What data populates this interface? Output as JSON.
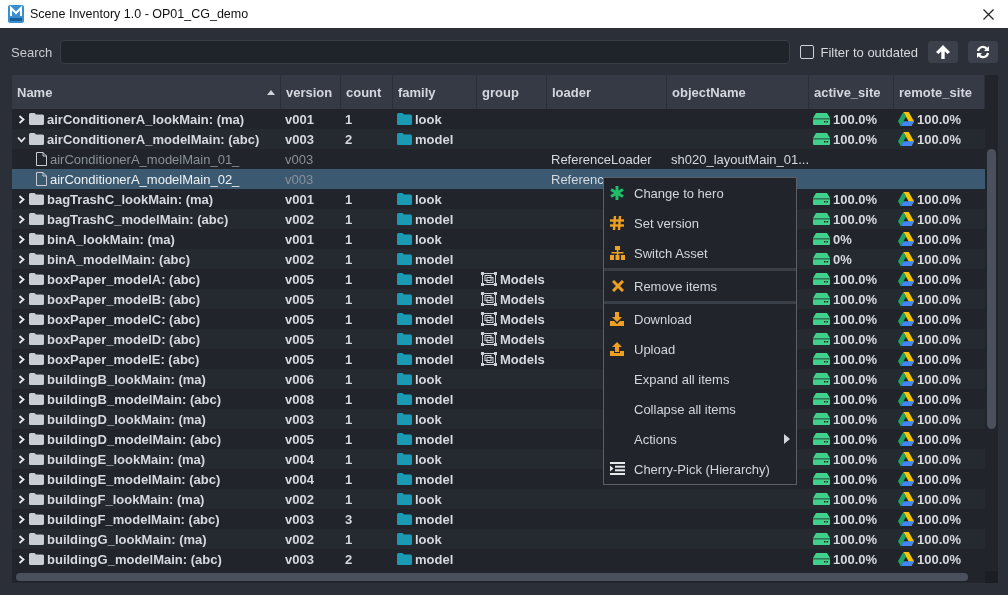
{
  "window": {
    "title": "Scene Inventory 1.0 - OP01_CG_demo"
  },
  "search": {
    "label": "Search"
  },
  "filter_outdated": {
    "label": "Filter to outdated",
    "checked": false
  },
  "table": {
    "columns": [
      {
        "label": "Name",
        "sorted": true
      },
      {
        "label": "version",
        "sorted": false
      },
      {
        "label": "count",
        "sorted": false
      },
      {
        "label": "family",
        "sorted": false
      },
      {
        "label": "group",
        "sorted": false
      },
      {
        "label": "loader",
        "sorted": false
      },
      {
        "label": "objectName",
        "sorted": false
      },
      {
        "label": "active_site",
        "sorted": false
      },
      {
        "label": "remote_site",
        "sorted": false
      }
    ],
    "rows": [
      {
        "name": "airConditionerA_lookMain: (ma)",
        "version": "v001",
        "count": "1",
        "family": "look",
        "active_site": "100.0%",
        "remote_site": "100.0%",
        "expanded": false,
        "selected": false
      },
      {
        "name": "airConditionerA_modelMain: (abc)",
        "version": "v003",
        "count": "2",
        "family": "model",
        "active_site": "100.0%",
        "remote_site": "100.0%",
        "expanded": true,
        "selected": false,
        "children": [
          {
            "name": "airConditionerA_modelMain_01_",
            "version": "v003",
            "loader": "ReferenceLoader",
            "objectName": "sh020_layoutMain_01...",
            "selected": false
          },
          {
            "name": "airConditionerA_modelMain_02_",
            "version": "v003",
            "loader": "Referenc",
            "selected": true
          }
        ]
      },
      {
        "name": "bagTrashC_lookMain: (ma)",
        "version": "v001",
        "count": "1",
        "family": "look",
        "active_site": "100.0%",
        "remote_site": "100.0%",
        "expanded": false,
        "selected": false
      },
      {
        "name": "bagTrashC_modelMain: (abc)",
        "version": "v002",
        "count": "1",
        "family": "model",
        "active_site": "100.0%",
        "remote_site": "100.0%",
        "expanded": false,
        "selected": false
      },
      {
        "name": "binA_lookMain: (ma)",
        "version": "v001",
        "count": "1",
        "family": "look",
        "active_site": "0%",
        "remote_site": "100.0%",
        "expanded": false,
        "selected": false
      },
      {
        "name": "binA_modelMain: (abc)",
        "version": "v002",
        "count": "1",
        "family": "model",
        "active_site": "0%",
        "remote_site": "100.0%",
        "expanded": false,
        "selected": false
      },
      {
        "name": "boxPaper_modelA: (abc)",
        "version": "v005",
        "count": "1",
        "family": "model",
        "group": "Models",
        "active_site": "100.0%",
        "remote_site": "100.0%",
        "expanded": false,
        "selected": false
      },
      {
        "name": "boxPaper_modelB: (abc)",
        "version": "v005",
        "count": "1",
        "family": "model",
        "group": "Models",
        "active_site": "100.0%",
        "remote_site": "100.0%",
        "expanded": false,
        "selected": false
      },
      {
        "name": "boxPaper_modelC: (abc)",
        "version": "v005",
        "count": "1",
        "family": "model",
        "group": "Models",
        "active_site": "100.0%",
        "remote_site": "100.0%",
        "expanded": false,
        "selected": false
      },
      {
        "name": "boxPaper_modelD: (abc)",
        "version": "v005",
        "count": "1",
        "family": "model",
        "group": "Models",
        "active_site": "100.0%",
        "remote_site": "100.0%",
        "expanded": false,
        "selected": false
      },
      {
        "name": "boxPaper_modelE: (abc)",
        "version": "v005",
        "count": "1",
        "family": "model",
        "group": "Models",
        "active_site": "100.0%",
        "remote_site": "100.0%",
        "expanded": false,
        "selected": false
      },
      {
        "name": "buildingB_lookMain: (ma)",
        "version": "v006",
        "count": "1",
        "family": "look",
        "active_site": "100.0%",
        "remote_site": "100.0%",
        "expanded": false,
        "selected": false
      },
      {
        "name": "buildingB_modelMain: (abc)",
        "version": "v008",
        "count": "1",
        "family": "model",
        "active_site": "100.0%",
        "remote_site": "100.0%",
        "expanded": false,
        "selected": false
      },
      {
        "name": "buildingD_lookMain: (ma)",
        "version": "v003",
        "count": "1",
        "family": "look",
        "active_site": "100.0%",
        "remote_site": "100.0%",
        "expanded": false,
        "selected": false
      },
      {
        "name": "buildingD_modelMain: (abc)",
        "version": "v005",
        "count": "1",
        "family": "model",
        "active_site": "100.0%",
        "remote_site": "100.0%",
        "expanded": false,
        "selected": false
      },
      {
        "name": "buildingE_lookMain: (ma)",
        "version": "v004",
        "count": "1",
        "family": "look",
        "active_site": "100.0%",
        "remote_site": "100.0%",
        "expanded": false,
        "selected": false
      },
      {
        "name": "buildingE_modelMain: (abc)",
        "version": "v004",
        "count": "1",
        "family": "model",
        "active_site": "100.0%",
        "remote_site": "100.0%",
        "expanded": false,
        "selected": false
      },
      {
        "name": "buildingF_lookMain: (ma)",
        "version": "v002",
        "count": "1",
        "family": "look",
        "active_site": "100.0%",
        "remote_site": "100.0%",
        "expanded": false,
        "selected": false
      },
      {
        "name": "buildingF_modelMain: (abc)",
        "version": "v003",
        "count": "3",
        "family": "model",
        "active_site": "100.0%",
        "remote_site": "100.0%",
        "expanded": false,
        "selected": false
      },
      {
        "name": "buildingG_lookMain: (ma)",
        "version": "v002",
        "count": "1",
        "family": "look",
        "active_site": "100.0%",
        "remote_site": "100.0%",
        "expanded": false,
        "selected": false
      },
      {
        "name": "buildingG_modelMain: (abc)",
        "version": "v003",
        "count": "2",
        "family": "model",
        "active_site": "100.0%",
        "remote_site": "100.0%",
        "expanded": false,
        "selected": false
      }
    ]
  },
  "context_menu": {
    "groups": [
      [
        {
          "label": "Change to hero",
          "kind": "hero"
        },
        {
          "label": "Set version",
          "kind": "version"
        },
        {
          "label": "Switch Asset",
          "kind": "switch"
        }
      ],
      [
        {
          "label": "Remove items",
          "kind": "remove"
        }
      ],
      [
        {
          "label": "Download",
          "kind": "download"
        },
        {
          "label": "Upload",
          "kind": "upload"
        },
        {
          "label": "Expand all items",
          "kind": "plain"
        },
        {
          "label": "Collapse all items",
          "kind": "plain"
        },
        {
          "label": "Actions",
          "kind": "submenu"
        },
        {
          "label": "Cherry-Pick (Hierarchy)",
          "kind": "hierarchy"
        }
      ]
    ]
  }
}
